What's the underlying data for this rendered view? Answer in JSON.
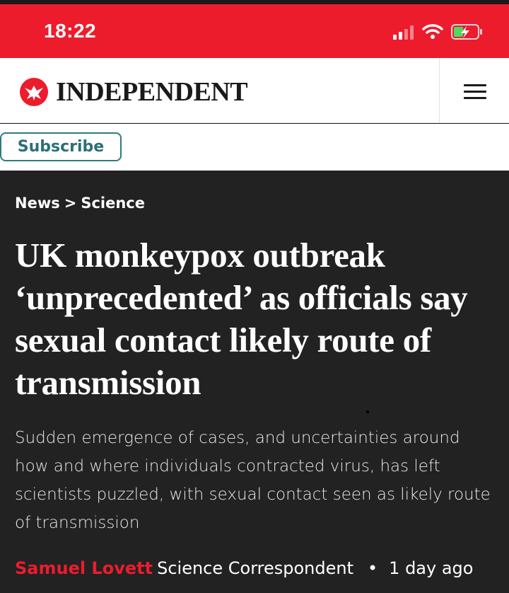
{
  "status_bar": {
    "time": "18:22",
    "icons": [
      "cellular-signal-icon",
      "wifi-icon",
      "battery-charging-icon"
    ],
    "background_color": "#ec1c2d"
  },
  "header": {
    "logo_text": "INDEPENDENT",
    "logo_icon": "eagle-icon",
    "menu_icon": "hamburger-menu-icon"
  },
  "subscribe": {
    "label": "Subscribe",
    "accent_color": "#2f7b7e"
  },
  "article": {
    "breadcrumb": [
      "News",
      "Science"
    ],
    "breadcrumb_separator": ">",
    "headline": "UK monkeypox outbreak ‘unprecedented’ as officials say sexual contact likely route of transmission",
    "standfirst": "Sudden emergence of cases, and uncertainties around how and where individuals contracted virus, has left scientists puzzled, with sexual contact seen as likely route of transmission",
    "byline": {
      "author": "Samuel Lovett",
      "role": "Science Correspondent",
      "separator": "•",
      "time": "1 day ago"
    },
    "background_color": "#222222",
    "author_color": "#ec1c2d"
  }
}
